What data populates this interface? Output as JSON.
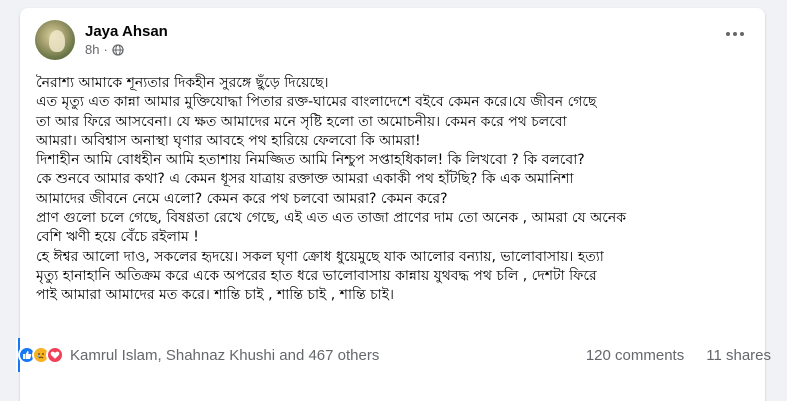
{
  "post": {
    "author": "Jaya Ahsan",
    "time": "8h",
    "privacy_icon": "globe-icon",
    "more_icon": "more-options-icon",
    "paragraphs": [
      "নৈরাশ্য আমাকে শূন্যতার দিকহীন সুরঙ্গে ছুঁড়ে দিয়েছে।",
      "এত মৃত্যু এত কান্না আমার মুক্তিযোদ্ধা পিতার রক্ত-ঘামের বাংলাদেশে বইবে কেমন করে।যে জীবন গেছে",
      "তা আর ফিরে আসবেনা। যে ক্ষত আমাদের মনে সৃষ্টি হলো তা অমোচনীয়। কেমন করে পথ চলবো",
      "আমরা। অবিশ্বাস অনাস্থা ঘৃণার আবহে পথ হারিয়ে ফেলবো কি আমরা!",
      "দিশাহীন আমি বোধহীন আমি হতাশায় নিমজ্জিত আমি নিশ্চুপ সপ্তাহধিকাল! কি লিখবো ? কি বলবো?",
      "কে শুনবে আমার কথা? এ কেমন ধূসর যাত্রায় রক্তাক্ত আমরা একাকী পথ হাঁটছি? কি এক অমানিশা",
      "আমাদের জীবনে নেমে এলো? কেমন করে পথ চলবো আমরা? কেমন করে?",
      "প্রাণ গুলো চলে গেছে, বিষণ্ণতা রেখে গেছে, এই এত এত তাজা প্রাণের দাম তো অনেক , আমরা যে অনেক",
      "বেশি ঋণী হয়ে বেঁচে রইলাম !",
      "হে ঈশ্বর আলো দাও,  সকলের হৃদয়ে। সকল ঘৃণা ক্রোধ ধুয়েমুছে যাক আলোর বন্যায়, ভালোবাসায়।  হত্যা",
      "মৃত্যু হানাহানি অতিক্রম করে একে অপরের হাত ধরে ভালোবাসায় কান্নায় যুথবদ্ধ পথ চলি , দেশটা ফিরে",
      "পাই আমারা আমাদের মত করে। শান্তি চাই , শান্তি চাই , শান্তি চাই।"
    ]
  },
  "footer": {
    "reaction_icons": [
      "like-icon",
      "sad-icon",
      "love-icon"
    ],
    "reactors": "Kamrul Islam, Shahnaz Khushi and 467 others",
    "comments": "120 comments",
    "shares": "11 shares"
  },
  "colors": {
    "accent": "#1877f2",
    "secondary_text": "#65676b",
    "love": "#f33e58",
    "sad": "#f7b125"
  }
}
